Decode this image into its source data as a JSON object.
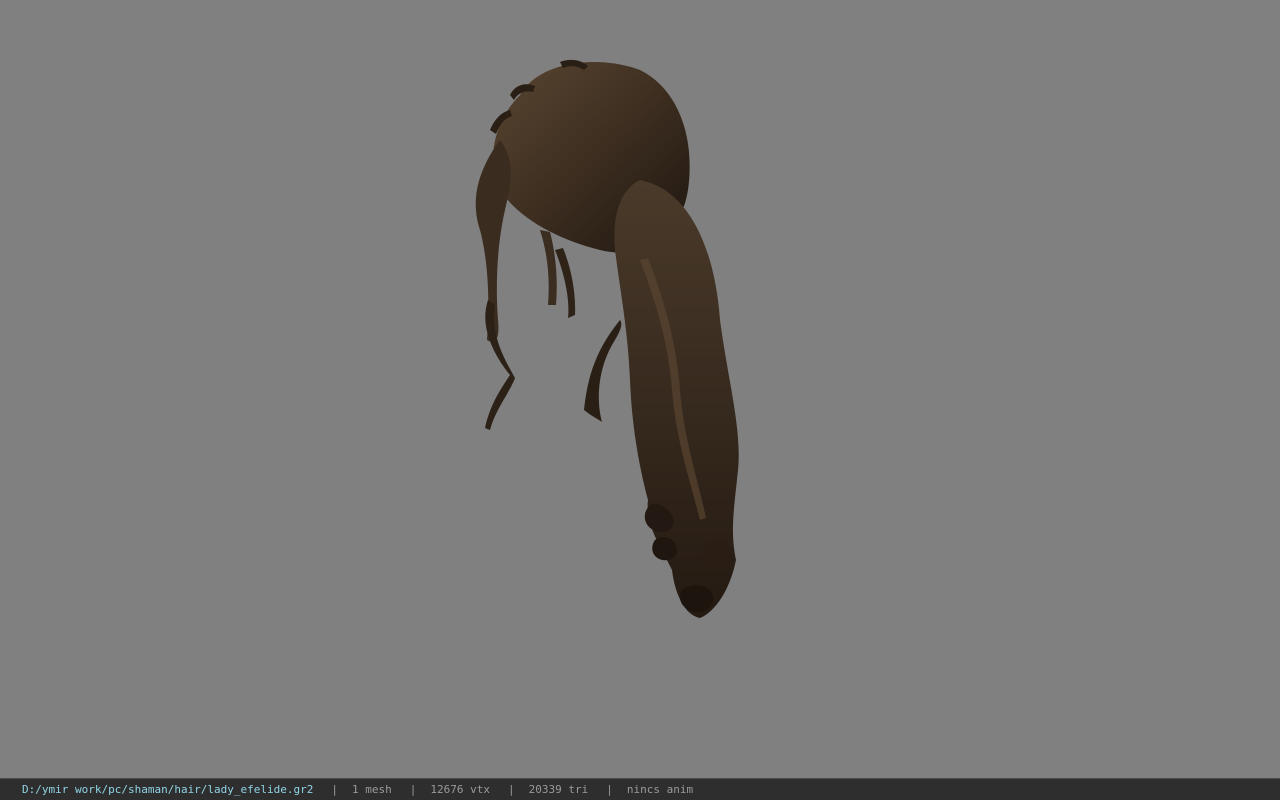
{
  "viewer": {
    "background_color": "#808080",
    "model_icon": "hair-mesh-icon"
  },
  "status_bar": {
    "file_path": "D:/ymir work/pc/shaman/hair/lady_efelide.gr2",
    "separator": "|",
    "mesh_count": "1 mesh",
    "vertex_count": "12676 vtx",
    "triangle_count": "20339 tri",
    "anim_status": "nincs anim",
    "path_color": "#8fd3e6",
    "text_color": "#9a9a9a"
  }
}
